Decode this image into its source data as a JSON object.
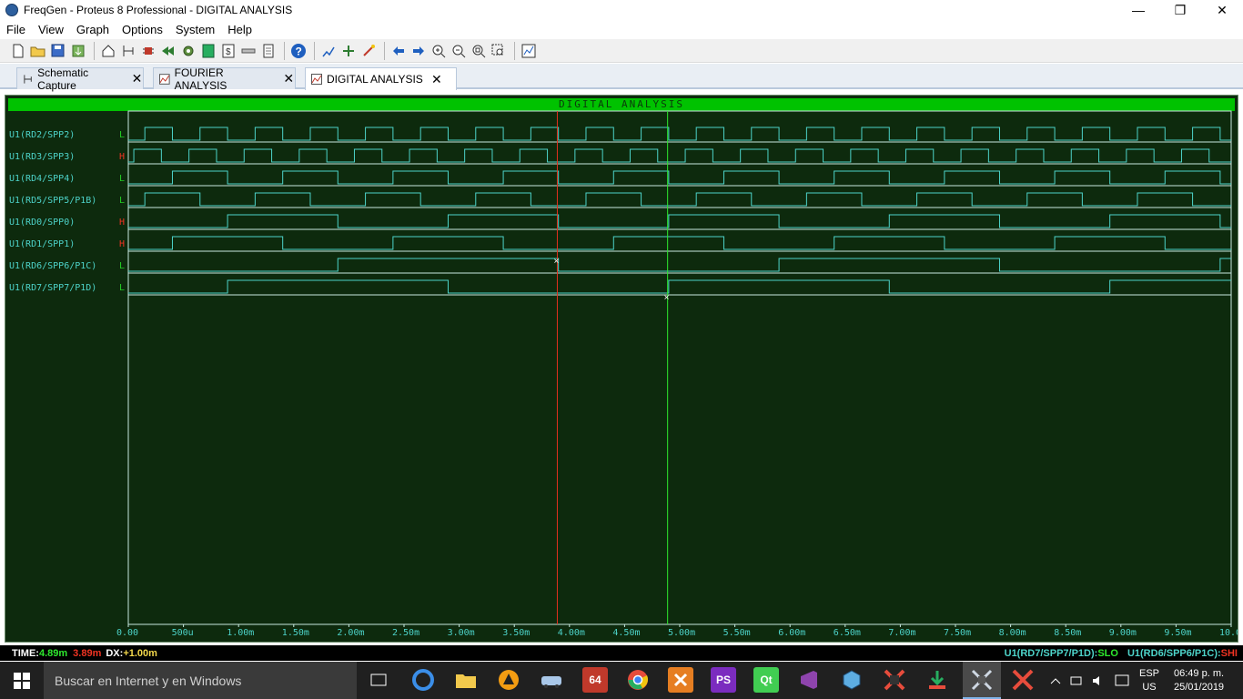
{
  "window": {
    "title": "FreqGen - Proteus 8 Professional - DIGITAL ANALYSIS",
    "minimize": "—",
    "maximize": "❐",
    "close": "✕"
  },
  "menu": [
    "File",
    "View",
    "Graph",
    "Options",
    "System",
    "Help"
  ],
  "tabs": [
    {
      "label": "Schematic Capture",
      "close": "✕"
    },
    {
      "label": "FOURIER ANALYSIS",
      "close": "✕"
    },
    {
      "label": "DIGITAL ANALYSIS",
      "close": "✕"
    }
  ],
  "graph": {
    "title": "DIGITAL ANALYSIS",
    "signals": [
      {
        "name": "U1(RD2/SPP2)",
        "state": "L",
        "state_color": "#22cc22"
      },
      {
        "name": "U1(RD3/SPP3)",
        "state": "H",
        "state_color": "#ee3322"
      },
      {
        "name": "U1(RD4/SPP4)",
        "state": "L",
        "state_color": "#22cc22"
      },
      {
        "name": "U1(RD5/SPP5/P1B)",
        "state": "L",
        "state_color": "#22cc22"
      },
      {
        "name": "U1(RD0/SPP0)",
        "state": "H",
        "state_color": "#ee3322"
      },
      {
        "name": "U1(RD1/SPP1)",
        "state": "H",
        "state_color": "#ee3322"
      },
      {
        "name": "U1(RD6/SPP6/P1C)",
        "state": "L",
        "state_color": "#22cc22"
      },
      {
        "name": "U1(RD7/SPP7/P1D)",
        "state": "L",
        "state_color": "#22cc22"
      }
    ],
    "x_ticks": [
      "0.00",
      "500u",
      "1.00m",
      "1.50m",
      "2.00m",
      "2.50m",
      "3.00m",
      "3.50m",
      "4.00m",
      "4.50m",
      "5.00m",
      "5.50m",
      "6.00m",
      "6.50m",
      "7.00m",
      "7.50m",
      "8.00m",
      "8.50m",
      "9.00m",
      "9.50m",
      "10.0m"
    ],
    "x_range": [
      0,
      10
    ],
    "cursor_primary_ms": 4.89,
    "cursor_secondary_ms": 3.89,
    "colors": {
      "background": "#0d2a0d",
      "trace": "#4dd3c9",
      "grid_line": "#c8e8e0",
      "title_bar": "#00c200",
      "primary_cursor": "#2ee82e",
      "secondary_cursor": "#e0301e",
      "label": "#4dd3c9"
    }
  },
  "status": {
    "time_label": "TIME:",
    "time_value": "4.89m",
    "time2_value": "3.89m",
    "dx_label": "DX:",
    "dx_value": "+1.00m",
    "right_a_label": "U1(RD7/SPP7/P1D):",
    "right_a_value": "SLO",
    "right_b_label": "U1(RD6/SPP6/P1C):",
    "right_b_value": "SHI"
  },
  "taskbar": {
    "search_placeholder": "Buscar en Internet y en Windows",
    "lang_top": "ESP",
    "lang_bottom": "US",
    "time": "06:49 p. m.",
    "date": "25/01/2019",
    "app64_label": "64",
    "appPS_label": "PS",
    "appQt_label": "Qt"
  }
}
